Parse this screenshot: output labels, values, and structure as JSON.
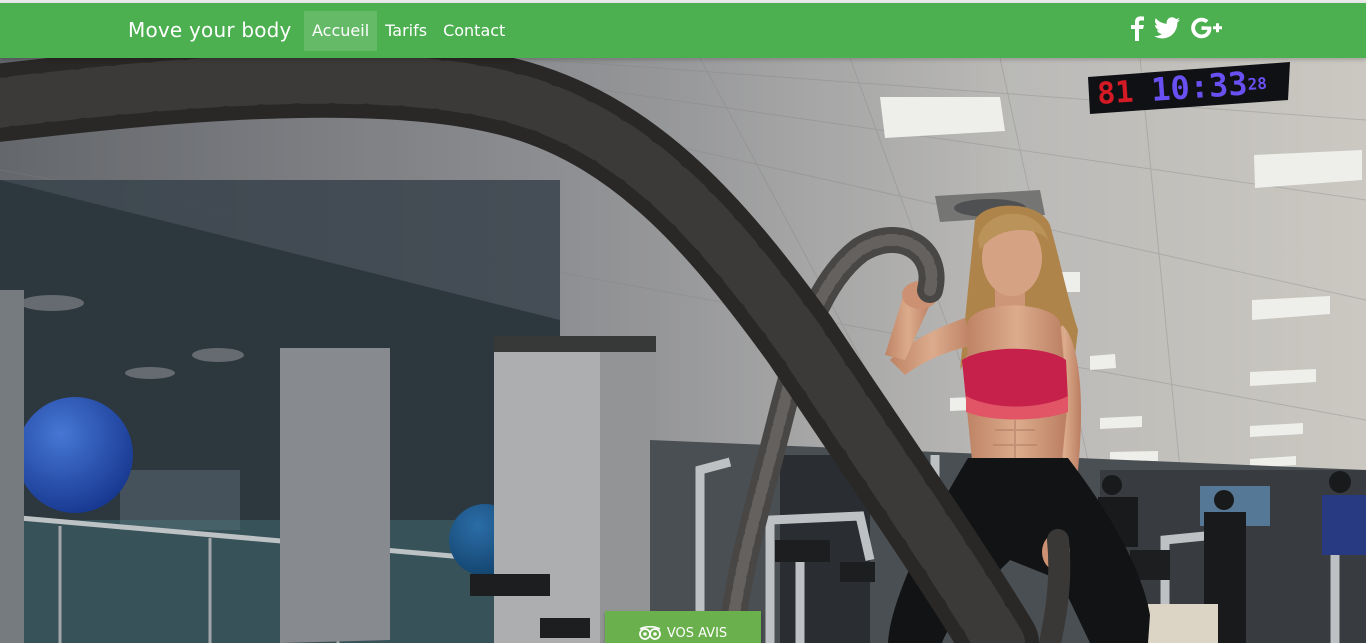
{
  "navbar": {
    "brand": "Move your body",
    "items": [
      {
        "label": "Accueil",
        "active": true
      },
      {
        "label": "Tarifs",
        "active": false
      },
      {
        "label": "Contact",
        "active": false
      }
    ],
    "social": [
      "facebook-icon",
      "twitter-icon",
      "google-plus-icon"
    ],
    "color": "#4caf50"
  },
  "hero": {
    "clock": {
      "left": "81",
      "right": "10:33",
      "seconds": "28"
    },
    "cta_label": "VOS AVIS",
    "cta_icon": "tripadvisor-owl-icon",
    "cta_color": "#6ab04c",
    "carousel": {
      "count": 3,
      "active": 0
    }
  }
}
